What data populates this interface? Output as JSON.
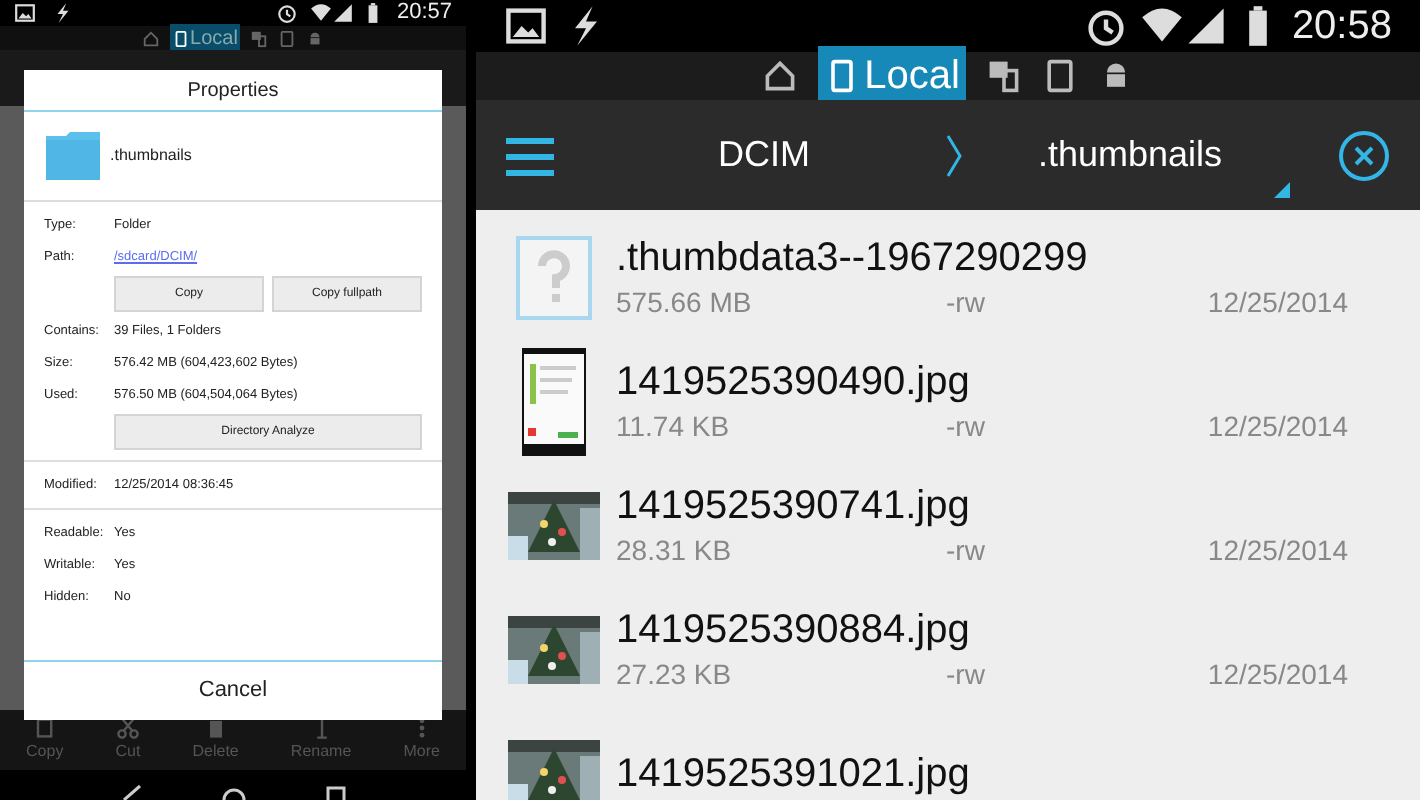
{
  "left_screen": {
    "status_bar": {
      "time": "20:57"
    },
    "locations": [
      {
        "kind": "home",
        "selected": false
      },
      {
        "kind": "local",
        "label": "Local",
        "selected": true
      },
      {
        "kind": "network",
        "selected": false
      },
      {
        "kind": "device",
        "selected": false
      },
      {
        "kind": "android",
        "selected": false
      }
    ],
    "dialog": {
      "title": "Properties",
      "folder_name": ".thumbnails",
      "sections": [
        {
          "items": [
            {
              "kind": "row",
              "label": "Type:",
              "value": "Folder"
            },
            {
              "kind": "link",
              "label": "Path:",
              "value": "/sdcard/DCIM/"
            },
            {
              "kind": "buttons",
              "buttons": [
                "Copy",
                "Copy fullpath"
              ]
            },
            {
              "kind": "row",
              "label": "Contains:",
              "value": "39 Files, 1 Folders"
            },
            {
              "kind": "row",
              "label": "Size:",
              "value": "576.42 MB (604,423,602 Bytes)"
            },
            {
              "kind": "row",
              "label": "Used:",
              "value": "576.50 MB (604,504,064 Bytes)"
            },
            {
              "kind": "buttons",
              "buttons": [
                "Directory Analyze"
              ]
            }
          ]
        },
        {
          "items": [
            {
              "kind": "row",
              "label": "Modified:",
              "value": "12/25/2014 08:36:45"
            }
          ]
        },
        {
          "items": [
            {
              "kind": "row",
              "label": "Readable:",
              "value": "Yes"
            },
            {
              "kind": "row",
              "label": "Writable:",
              "value": "Yes"
            },
            {
              "kind": "row",
              "label": "Hidden:",
              "value": "No"
            }
          ]
        }
      ],
      "cancel": "Cancel"
    },
    "actions": [
      {
        "kind": "copy",
        "label": "Copy"
      },
      {
        "kind": "cut",
        "label": "Cut"
      },
      {
        "kind": "delete",
        "label": "Delete"
      },
      {
        "kind": "rename",
        "label": "Rename"
      },
      {
        "kind": "more",
        "label": "More"
      }
    ]
  },
  "right_screen": {
    "status_bar": {
      "time": "20:58"
    },
    "locations": [
      {
        "kind": "home",
        "selected": false
      },
      {
        "kind": "local",
        "label": "Local",
        "selected": true
      },
      {
        "kind": "network",
        "selected": false
      },
      {
        "kind": "device",
        "selected": false
      },
      {
        "kind": "android",
        "selected": false
      }
    ],
    "breadcrumb": {
      "parent": "DCIM",
      "current": ".thumbnails"
    },
    "files": [
      {
        "kind": "unknown",
        "name": ".thumbdata3--1967290299",
        "size": "575.66 MB",
        "permissions": "-rw",
        "date": "12/25/2014"
      },
      {
        "kind": "screenshot",
        "name": "1419525390490.jpg",
        "size": "11.74 KB",
        "permissions": "-rw",
        "date": "12/25/2014"
      },
      {
        "kind": "picture",
        "name": "1419525390741.jpg",
        "size": "28.31 KB",
        "permissions": "-rw",
        "date": "12/25/2014"
      },
      {
        "kind": "picture",
        "name": "1419525390884.jpg",
        "size": "27.23 KB",
        "permissions": "-rw",
        "date": "12/25/2014"
      },
      {
        "kind": "picture",
        "name": "1419525391021.jpg"
      }
    ]
  }
}
